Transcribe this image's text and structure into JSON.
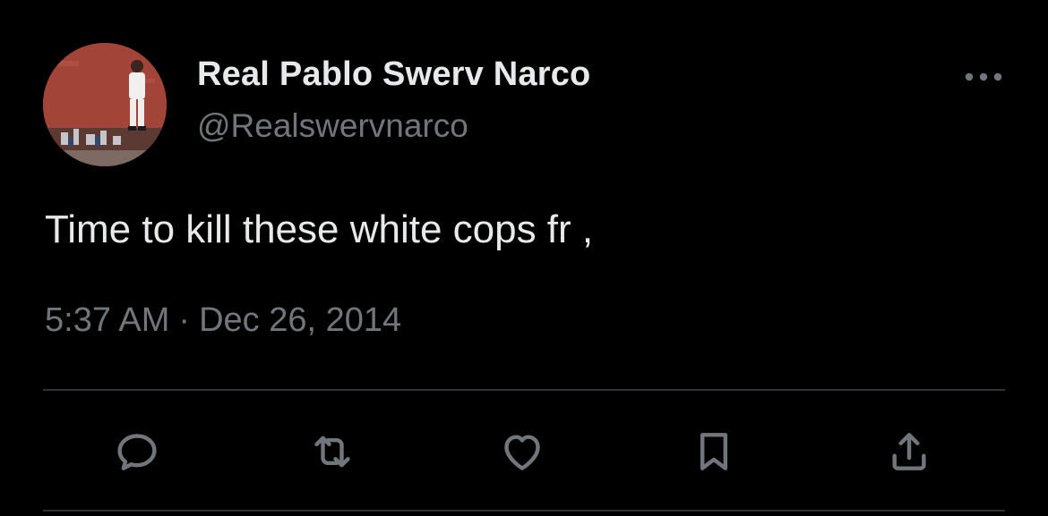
{
  "user": {
    "display_name": "Real Pablo Swerv Narco",
    "handle": "@Realswervnarco",
    "avatar_icon": "profile-photo"
  },
  "tweet": {
    "text": "Time to kill these white cops fr ,",
    "time": "5:37 AM",
    "separator": "·",
    "date": "Dec 26, 2014"
  },
  "actions": [
    {
      "name": "reply",
      "icon": "reply-icon"
    },
    {
      "name": "retweet",
      "icon": "retweet-icon"
    },
    {
      "name": "like",
      "icon": "heart-icon"
    },
    {
      "name": "bookmark",
      "icon": "bookmark-icon"
    },
    {
      "name": "share",
      "icon": "share-icon"
    }
  ],
  "colors": {
    "background": "#000000",
    "primary_text": "#e7e9ea",
    "secondary_text": "#71767b",
    "divider": "#2f3336"
  }
}
